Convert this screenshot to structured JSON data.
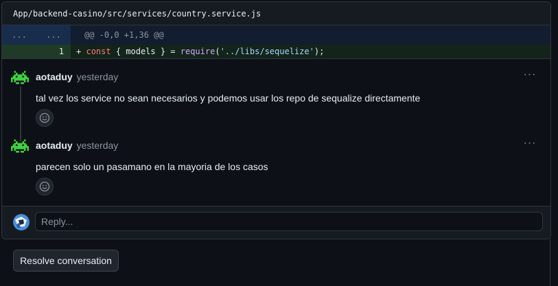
{
  "file": {
    "path": "App/backend-casino/src/services/country.service.js"
  },
  "diff": {
    "hunk_left_gutter": "...",
    "hunk_right_gutter": "...",
    "hunk_header": "@@ -0,0 +1,36 @@",
    "added_line_number": "1",
    "added_line": {
      "prefix": "+",
      "kw": "const",
      "p1": " { models } = ",
      "fn": "require",
      "p2": "(",
      "str": "'../libs/sequelize'",
      "p3": ");"
    }
  },
  "thread": {
    "comments": [
      {
        "author": "aotaduy",
        "time": "yesterday",
        "body": "tal vez los service no sean necesarios y podemos usar los repo de sequalize directamente",
        "avatar_icon": "space-invader-icon"
      },
      {
        "author": "aotaduy",
        "time": "yesterday",
        "body": "parecen solo un pasamano en la mayoria de los casos",
        "avatar_icon": "space-invader-icon"
      }
    ],
    "more_label": "···",
    "reply_placeholder": "Reply..."
  },
  "actions": {
    "resolve_label": "Resolve conversation"
  },
  "colors": {
    "background": "#0d1117",
    "avatar_green": "#3fd33f",
    "hunk_bg": "#121d2f",
    "add_bg": "#13241a"
  }
}
